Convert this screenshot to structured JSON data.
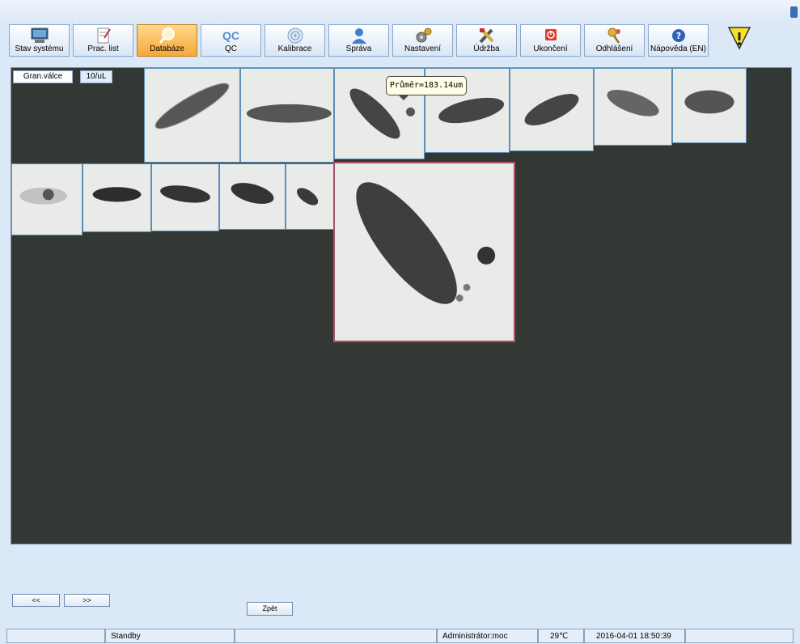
{
  "window": {
    "title": "FUS-2000 hybridní močový analyzátor (CZ-MKo-150122-CSLV)-->Databáze"
  },
  "toolbar": {
    "items": [
      {
        "label": "Stav systému",
        "icon": "monitor-icon"
      },
      {
        "label": "Prac. list",
        "icon": "worklist-icon"
      },
      {
        "label": "Databáze",
        "icon": "magnifier-icon",
        "active": true
      },
      {
        "label": "QC",
        "icon": "qc-icon",
        "icon_text": "QC"
      },
      {
        "label": "Kalibrace",
        "icon": "target-icon"
      },
      {
        "label": "Správa",
        "icon": "user-icon"
      },
      {
        "label": "Nastavení",
        "icon": "gears-icon"
      },
      {
        "label": "Údržba",
        "icon": "tools-icon"
      },
      {
        "label": "Ukončení",
        "icon": "power-icon"
      },
      {
        "label": "Odhlášení",
        "icon": "keys-icon"
      },
      {
        "label": "Nápověda (EN)",
        "icon": "help-icon"
      }
    ],
    "warning_icon": "warning-triangle-icon"
  },
  "gallery": {
    "category_label": "Gran.válce",
    "concentration_label": "10/uL",
    "tooltip": "Průměr=183.14um",
    "image_count": 14,
    "selected_image": 14
  },
  "nav": {
    "prev_label": "<<",
    "next_label": ">>",
    "back_label": "Zpět"
  },
  "status": {
    "left": "",
    "state": "Standby",
    "message": "",
    "user": "Administrátor:moc",
    "temperature": "29℃",
    "datetime": "2016-04-01 18:50:39",
    "extra": ""
  },
  "colors": {
    "toolbar_active": "#f5a93a",
    "gallery_bg": "#343834",
    "tile_border": "#5b8fb8",
    "selected_border": "#b0506a"
  }
}
